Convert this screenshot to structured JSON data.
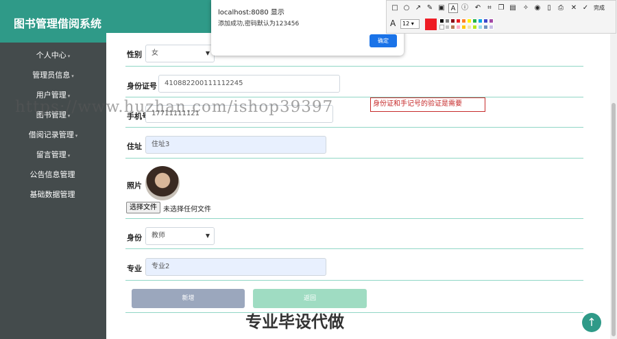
{
  "app": {
    "title": "图书管理借阅系统"
  },
  "sidebar": {
    "items": [
      {
        "label": "个人中心",
        "caret": "▾"
      },
      {
        "label": "管理员信息",
        "caret": "▾"
      },
      {
        "label": "用户管理",
        "caret": "▾"
      },
      {
        "label": "图书管理",
        "caret": "▾"
      },
      {
        "label": "借阅记录管理",
        "caret": "▾"
      },
      {
        "label": "留言管理",
        "caret": "▾"
      },
      {
        "label": "公告信息管理",
        "caret": ""
      },
      {
        "label": "基础数据管理",
        "caret": ""
      }
    ]
  },
  "form": {
    "gender_label": "性别",
    "gender_value": "女",
    "idcard_label": "身份证号",
    "idcard_value": "410882200111112245",
    "phone_label": "手机号",
    "phone_value": "17711111121",
    "address_label": "住址",
    "address_value": "住址3",
    "photo_label": "照片",
    "file_button": "选择文件",
    "file_status": "未选择任何文件",
    "role_label": "身份",
    "role_value": "教师",
    "major_label": "专业",
    "major_value": "专业2",
    "add_button": "新增",
    "back_button": "返回"
  },
  "annotation": {
    "note_text": "身份证和手记号的验证是需要"
  },
  "watermark": {
    "text": "https://www.huzhan.com/ishop39397"
  },
  "banner": {
    "text": "专业毕设代做"
  },
  "dialog": {
    "title": "localhost:8080 显示",
    "message": "添加成功,密码默认为123456",
    "ok_label": "确定"
  },
  "snap_toolbar": {
    "done_label": "完成",
    "font_size": "12",
    "current_color": "#ee1c24",
    "palette": [
      "#000000",
      "#7f7f7f",
      "#880015",
      "#ed1c24",
      "#ff7f27",
      "#fff200",
      "#22b14c",
      "#00a2e8",
      "#3f48cc",
      "#a349a4",
      "#ffffff",
      "#c3c3c3",
      "#b97a57",
      "#ffaec9",
      "#ffc90e",
      "#efe4b0",
      "#b5e61d",
      "#99d9ea",
      "#7092be",
      "#c8bfe7"
    ]
  },
  "header_icons": {
    "left": "shuffle-icon",
    "right": "user-icon"
  }
}
